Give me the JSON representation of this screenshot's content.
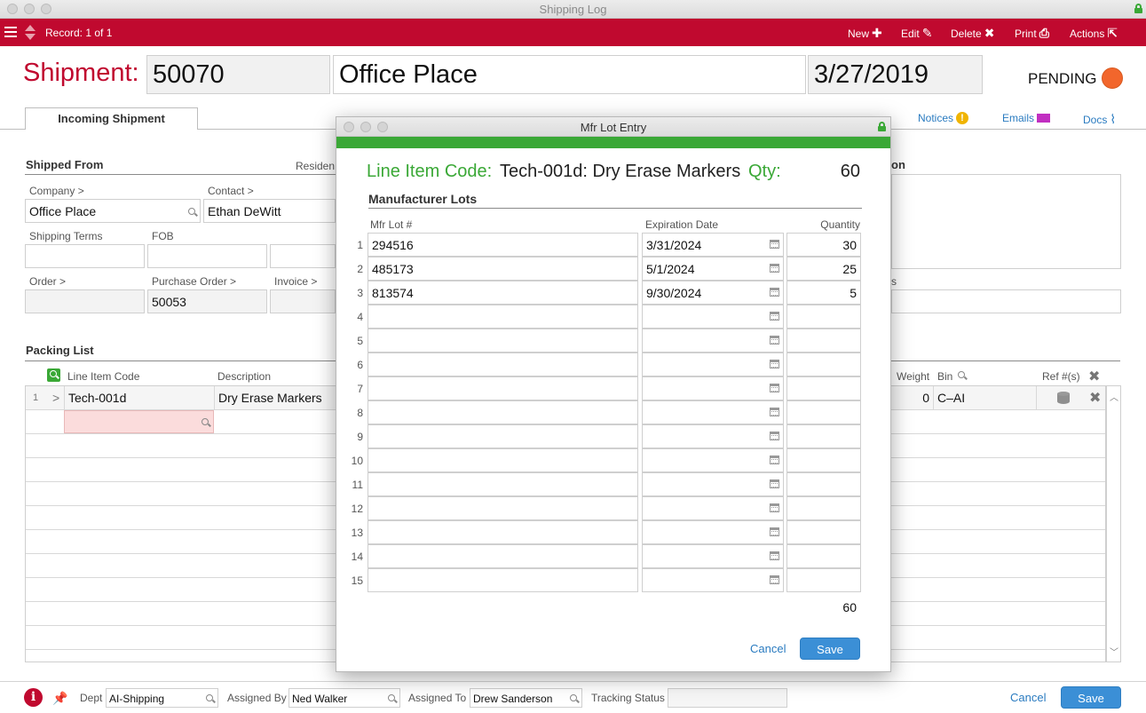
{
  "window": {
    "title": "Shipping Log"
  },
  "toolbar": {
    "record": "Record: 1 of 1",
    "new_label": "New",
    "edit_label": "Edit",
    "delete_label": "Delete",
    "print_label": "Print",
    "actions_label": "Actions"
  },
  "header": {
    "label": "Shipment:",
    "number": "50070",
    "company": "Office Place",
    "date": "3/27/2019",
    "status": "PENDING",
    "status_color": "#f2662c"
  },
  "tabs": {
    "active": "Incoming Shipment"
  },
  "links": {
    "notices": "Notices",
    "emails": "Emails",
    "docs": "Docs"
  },
  "shipped_from": {
    "title": "Shipped From",
    "residential_partial": "Residen",
    "company_label": "Company >",
    "company_value": "Office Place",
    "contact_label": "Contact >",
    "contact_value": "Ethan DeWitt",
    "shipping_terms_label": "Shipping Terms",
    "fob_label": "FOB",
    "order_label": "Order >",
    "po_label": "Purchase Order >",
    "po_value": "50053",
    "invoice_label": "Invoice >",
    "right_title_partial": "on",
    "right_label_partial": "s"
  },
  "packing_list": {
    "title": "Packing List",
    "col_line_item": "Line Item Code",
    "col_description": "Description",
    "col_weight": "Weight",
    "col_bin": "Bin",
    "col_ref": "Ref #(s)",
    "rows": [
      {
        "num": "1",
        "expand": ">",
        "code": "Tech-001d",
        "description": "Dry Erase Markers",
        "weight": "0",
        "bin": "C–AI"
      }
    ]
  },
  "footer": {
    "dept_label": "Dept",
    "dept_value": "AI-Shipping",
    "assigned_by_label": "Assigned By",
    "assigned_by_value": "Ned Walker",
    "assigned_to_label": "Assigned To",
    "assigned_to_value": "Drew Sanderson",
    "tracking_label": "Tracking Status",
    "tracking_value": "",
    "cancel_label": "Cancel",
    "save_label": "Save"
  },
  "modal": {
    "title": "Mfr Lot Entry",
    "line_item_label": "Line Item Code:",
    "line_item_value": "Tech-001d: Dry Erase Markers",
    "qty_label": "Qty:",
    "qty_value": "60",
    "section": "Manufacturer Lots",
    "col_lot": "Mfr Lot #",
    "col_exp": "Expiration Date",
    "col_qty": "Quantity",
    "rows": [
      {
        "num": "1",
        "lot": "294516",
        "exp": "3/31/2024",
        "qty": "30"
      },
      {
        "num": "2",
        "lot": "485173",
        "exp": "5/1/2024",
        "qty": "25"
      },
      {
        "num": "3",
        "lot": "813574",
        "exp": "9/30/2024",
        "qty": "5"
      },
      {
        "num": "4",
        "lot": "",
        "exp": "",
        "qty": ""
      },
      {
        "num": "5",
        "lot": "",
        "exp": "",
        "qty": ""
      },
      {
        "num": "6",
        "lot": "",
        "exp": "",
        "qty": ""
      },
      {
        "num": "7",
        "lot": "",
        "exp": "",
        "qty": ""
      },
      {
        "num": "8",
        "lot": "",
        "exp": "",
        "qty": ""
      },
      {
        "num": "9",
        "lot": "",
        "exp": "",
        "qty": ""
      },
      {
        "num": "10",
        "lot": "",
        "exp": "",
        "qty": ""
      },
      {
        "num": "11",
        "lot": "",
        "exp": "",
        "qty": ""
      },
      {
        "num": "12",
        "lot": "",
        "exp": "",
        "qty": ""
      },
      {
        "num": "13",
        "lot": "",
        "exp": "",
        "qty": ""
      },
      {
        "num": "14",
        "lot": "",
        "exp": "",
        "qty": ""
      },
      {
        "num": "15",
        "lot": "",
        "exp": "",
        "qty": ""
      }
    ],
    "total": "60",
    "cancel_label": "Cancel",
    "save_label": "Save"
  }
}
